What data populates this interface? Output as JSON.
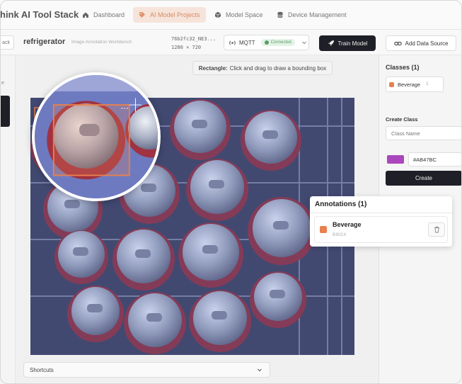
{
  "app": {
    "brand": "hink AI Tool Stack"
  },
  "nav": {
    "items": [
      {
        "label": "Dashboard",
        "icon": "home-icon",
        "active": false
      },
      {
        "label": "AI Model Projects",
        "icon": "tag-icon",
        "active": true
      },
      {
        "label": "Model Space",
        "icon": "cube-icon",
        "active": false
      },
      {
        "label": "Device Management",
        "icon": "database-icon",
        "active": false
      }
    ]
  },
  "toolbar": {
    "back_label": "ack",
    "project_title": "refrigerator",
    "project_subtitle": "Image Annotation Workbench",
    "image_id": "76b2fc32_NE3...",
    "image_size": "1280 × 720",
    "mqtt_label": "MQTT",
    "mqtt_status": "Connected",
    "train_label": "Train Model",
    "datasource_label": "Add Data Source"
  },
  "left_sidebar": {
    "letter": "e"
  },
  "canvas": {
    "hint_bold": "Rectangle:",
    "hint_text": "Click and drag to draw a bounding box",
    "shortcuts_label": "Shortcuts"
  },
  "classes": {
    "title": "Classes (1)",
    "items": [
      {
        "name": "Beverage",
        "count": "1",
        "color": "#E8804E"
      }
    ]
  },
  "create_class": {
    "title": "Create Class",
    "name_placeholder": "Class Name",
    "color_value": "#AB47BC",
    "color_swatch": "#AB47BC",
    "create_label": "Create"
  },
  "annotations": {
    "title": "Annotations (1)",
    "items": [
      {
        "label": "Beverage",
        "type": "BBOX",
        "color": "#E8804E"
      }
    ]
  },
  "colors": {
    "accent": "#E8804E",
    "dark": "#1F1F27",
    "nav_active_bg": "#F6E4DA",
    "connected": "#5A9C67"
  }
}
